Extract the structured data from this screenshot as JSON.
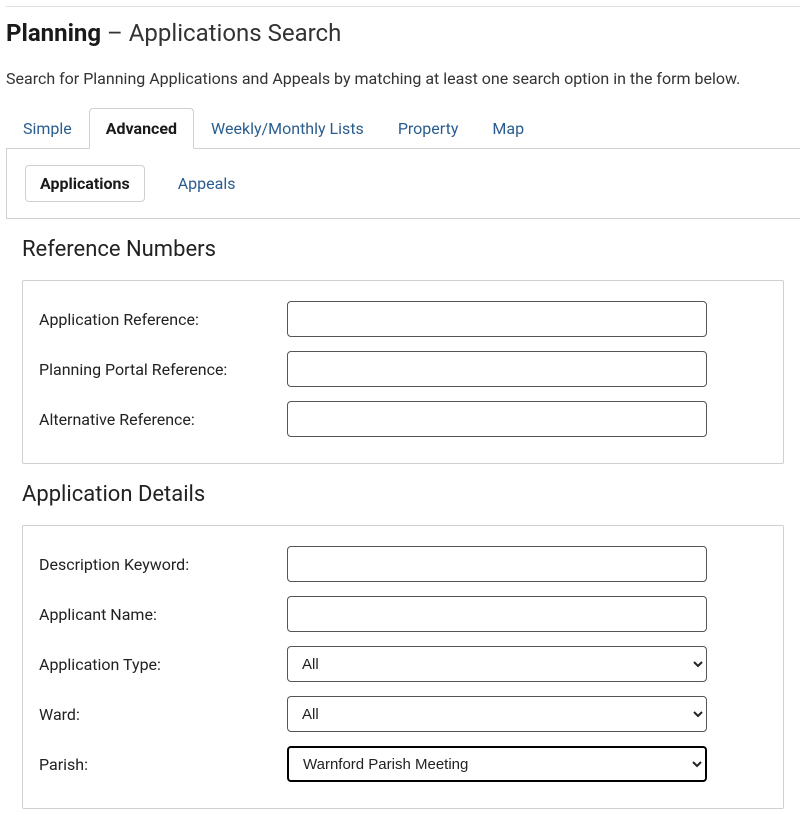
{
  "header": {
    "title_bold": "Planning",
    "title_rest": " – Applications Search",
    "description": "Search for Planning Applications and Appeals by matching at least one search option in the form below."
  },
  "main_tabs": [
    {
      "label": "Simple",
      "active": false
    },
    {
      "label": "Advanced",
      "active": true
    },
    {
      "label": "Weekly/Monthly Lists",
      "active": false
    },
    {
      "label": "Property",
      "active": false
    },
    {
      "label": "Map",
      "active": false
    }
  ],
  "sub_tabs": [
    {
      "label": "Applications",
      "active": true
    },
    {
      "label": "Appeals",
      "active": false
    }
  ],
  "sections": {
    "reference_numbers": {
      "title": "Reference Numbers",
      "fields": [
        {
          "label": "Application Reference:",
          "value": ""
        },
        {
          "label": "Planning Portal Reference:",
          "value": ""
        },
        {
          "label": "Alternative Reference:",
          "value": ""
        }
      ]
    },
    "application_details": {
      "title": "Application Details",
      "fields": [
        {
          "label": "Description Keyword:",
          "type": "text",
          "value": ""
        },
        {
          "label": "Applicant Name:",
          "type": "text",
          "value": ""
        },
        {
          "label": "Application Type:",
          "type": "select",
          "value": "All"
        },
        {
          "label": "Ward:",
          "type": "select",
          "value": "All"
        },
        {
          "label": "Parish:",
          "type": "select",
          "value": "Warnford Parish Meeting",
          "focused": true
        }
      ]
    }
  }
}
